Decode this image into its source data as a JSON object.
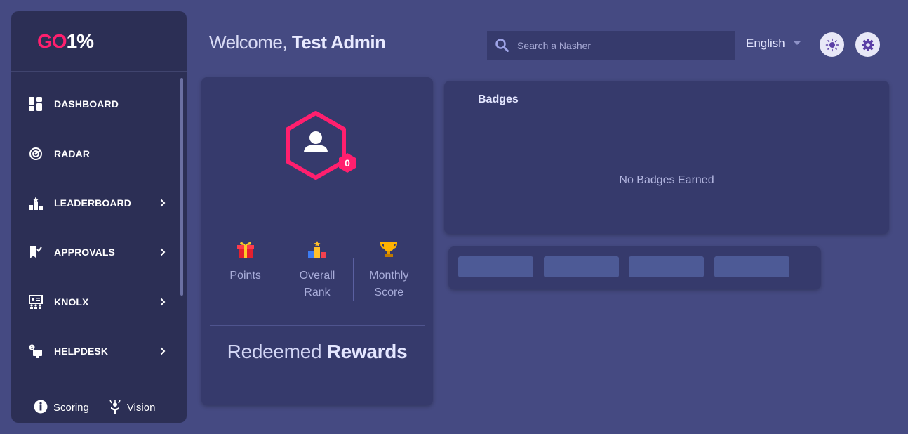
{
  "brand": {
    "logo_part1": "GO",
    "logo_part2": "1%",
    "logo_color": "#ff1f6e"
  },
  "sidebar": {
    "items": [
      {
        "label": "DASHBOARD",
        "icon": "dashboard-icon",
        "has_submenu": false
      },
      {
        "label": "RADAR",
        "icon": "radar-icon",
        "has_submenu": false
      },
      {
        "label": "LEADERBOARD",
        "icon": "leaderboard-icon",
        "has_submenu": true
      },
      {
        "label": "APPROVALS",
        "icon": "approvals-icon",
        "has_submenu": true
      },
      {
        "label": "KNOLX",
        "icon": "knolx-icon",
        "has_submenu": true
      },
      {
        "label": "HELPDESK",
        "icon": "helpdesk-icon",
        "has_submenu": true
      }
    ],
    "footer": {
      "scoring_label": "Scoring",
      "vision_label": "Vision"
    }
  },
  "header": {
    "welcome_prefix": "Welcome, ",
    "user_name": "Test Admin",
    "search_placeholder": "Search a Nasher",
    "language": "English"
  },
  "profile": {
    "level": "0",
    "stats": {
      "points_label": "Points",
      "overall_rank_line1": "Overall",
      "overall_rank_line2": "Rank",
      "monthly_score_line1": "Monthly",
      "monthly_score_line2": "Score"
    },
    "redeemed_prefix": "Redeemed ",
    "redeemed_bold": "Rewards"
  },
  "badges": {
    "title": "Badges",
    "empty_text": "No Badges Earned"
  },
  "colors": {
    "background": "#454a82",
    "sidebar": "#2c2f55",
    "card": "#363a6c",
    "accent": "#ff1f6e"
  }
}
